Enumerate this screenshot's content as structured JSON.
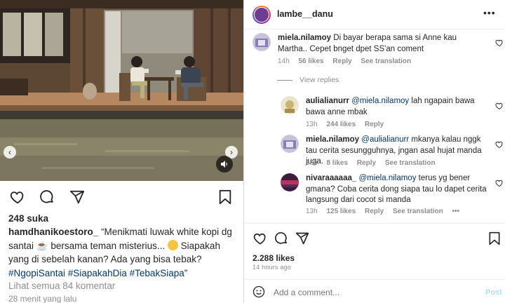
{
  "post": {
    "likes": "248 suka",
    "caption_user": "hamdhanikoestoro_",
    "caption_part1": "“Menikmati luwak white kopi dg santai ",
    "caption_emoji1": "☕",
    "caption_part2": " bersama teman misterius... ",
    "caption_part3": " Siapakah yang di sebelah kanan? Ada yang bisa tebak?",
    "hashtags": [
      "#NgopiSantai",
      "#SiapakahDia",
      "#TebakSiapa"
    ],
    "caption_end": "”",
    "view_all": "Lihat semua 84 komentar",
    "time": "28 menit yang lalu"
  },
  "right": {
    "username": "lambe__danu",
    "more": "•••",
    "view_replies": "View replies",
    "likes": "2.288 likes",
    "time": "14 hours ago",
    "add_comment_placeholder": "Add a comment...",
    "post_label": "Post"
  },
  "comments": [
    {
      "user": "miela.nilamoy",
      "text": "Di bayar berapa sama si Anne kau Martha.. Cepet bnget dpet SS'an coment",
      "time": "14h",
      "likes": "56 likes",
      "reply": "Reply",
      "see_translation": "See translation"
    },
    {
      "user": "aulialianurr",
      "mention": "@miela.nilamoy",
      "text": "lah ngapain bawa bawa anne mbak",
      "time": "13h",
      "likes": "244 likes",
      "reply": "Reply"
    },
    {
      "user": "miela.nilamoy",
      "mention": "@aulialianurr",
      "text": "mkanya kalau nggk tau cerita sesungguhnya, jngan asal hujat manda juga.",
      "time": "13h",
      "likes": "8 likes",
      "reply": "Reply",
      "see_translation": "See translation"
    },
    {
      "user": "nivaraaaaaa_",
      "mention": "@miela.nilamoy",
      "text": "terus yg bener gmana? Coba cerita dong siapa tau lo dapet cerita langsung dari cocot si manda",
      "time": "13h",
      "likes": "125 likes",
      "reply": "Reply",
      "see_translation": "See translation",
      "more": "•••"
    }
  ],
  "colors": {
    "link": "#00376b",
    "muted": "#8e8e8e",
    "text": "#262626",
    "border": "#dbdbdb"
  },
  "icons": [
    "heart-icon",
    "comment-icon",
    "share-icon",
    "bookmark-icon",
    "emoji-icon",
    "volume-icon",
    "chevron-left-icon",
    "chevron-right-icon"
  ]
}
